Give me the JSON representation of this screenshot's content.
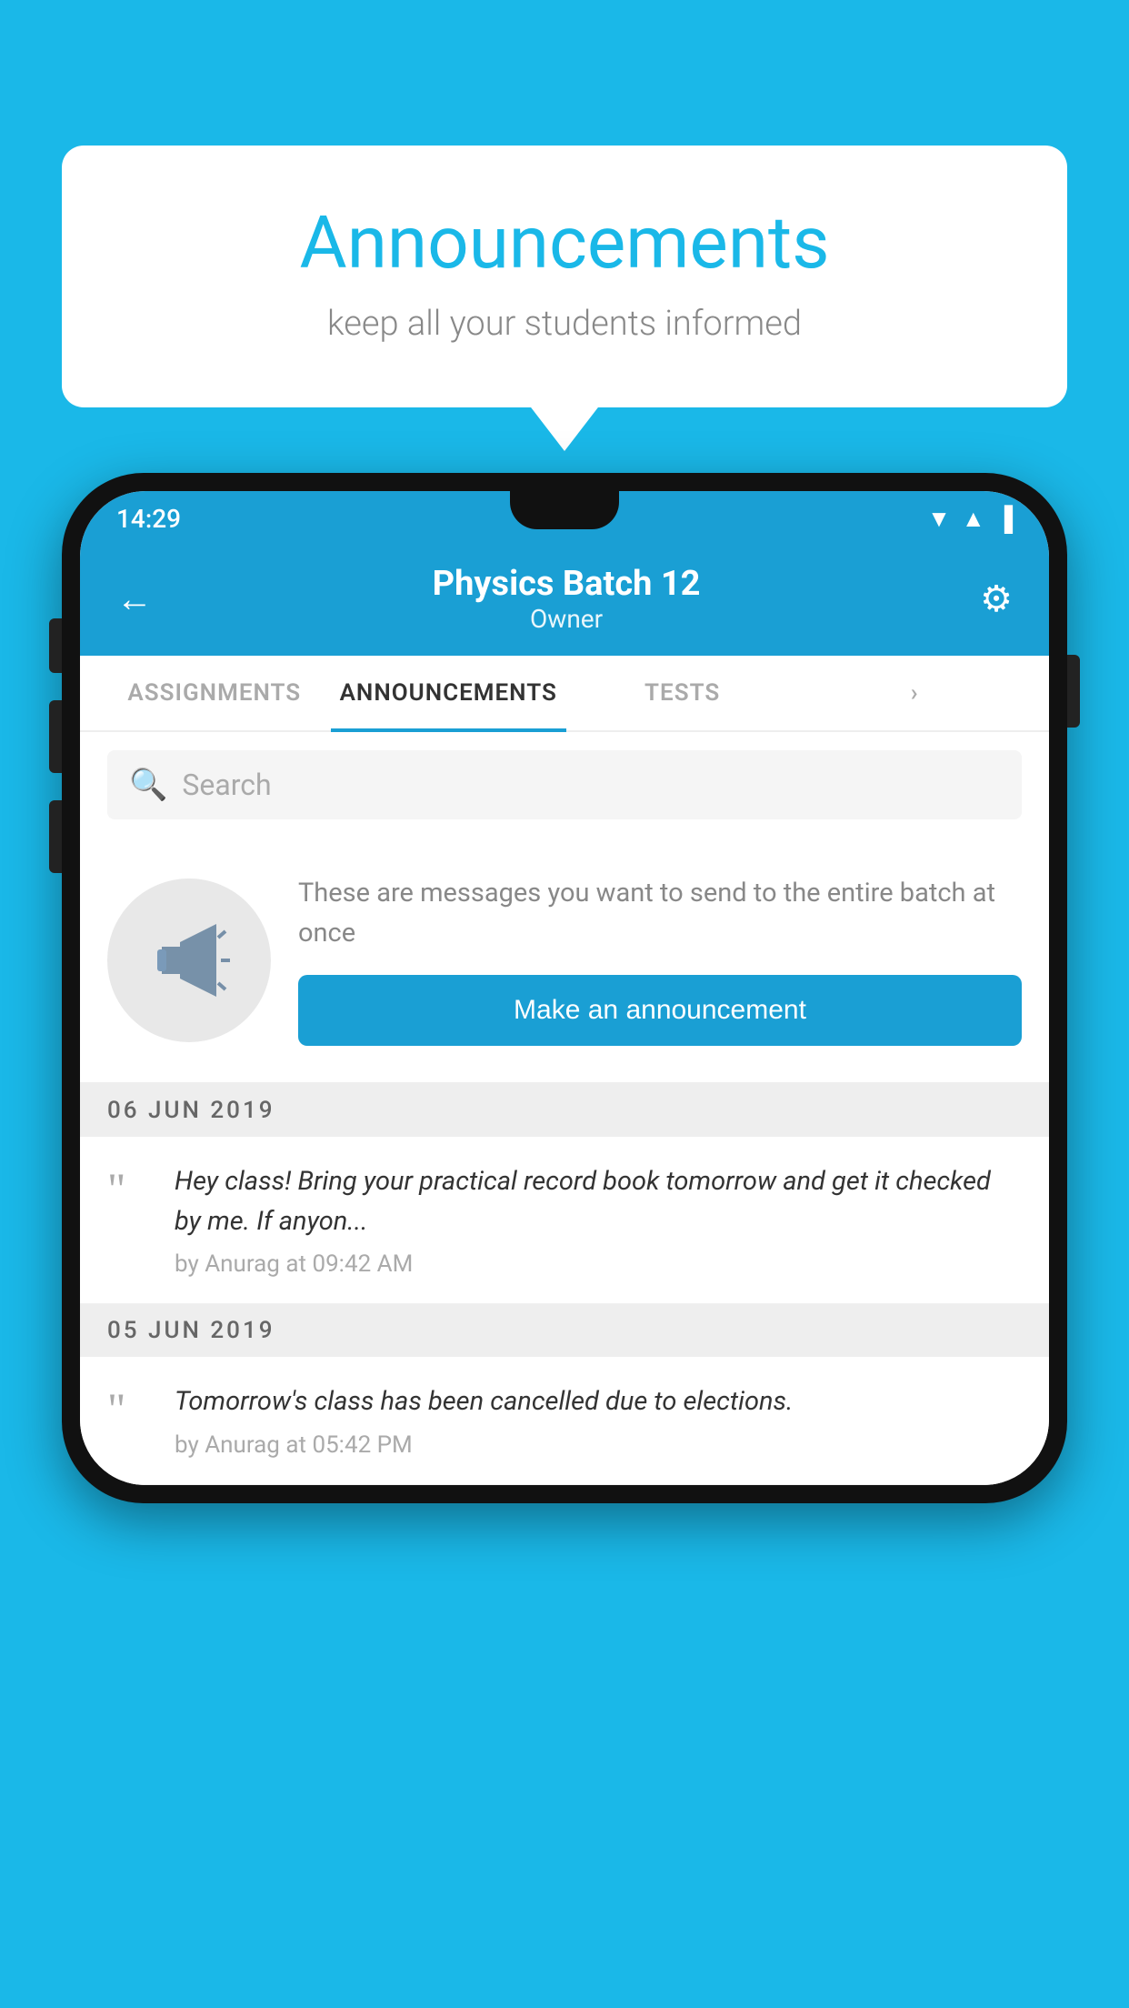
{
  "background_color": "#1ab8e8",
  "speech_bubble": {
    "title": "Announcements",
    "subtitle": "keep all your students informed"
  },
  "phone": {
    "status_bar": {
      "time": "14:29",
      "wifi": "▲",
      "signal": "▲",
      "battery": "▌"
    },
    "header": {
      "title": "Physics Batch 12",
      "subtitle": "Owner",
      "back_label": "←",
      "settings_label": "⚙"
    },
    "tabs": [
      {
        "label": "ASSIGNMENTS",
        "active": false
      },
      {
        "label": "ANNOUNCEMENTS",
        "active": true
      },
      {
        "label": "TESTS",
        "active": false
      },
      {
        "label": "›",
        "active": false
      }
    ],
    "search": {
      "placeholder": "Search"
    },
    "promo": {
      "description": "These are messages you want to\nsend to the entire batch at once",
      "button_label": "Make an announcement"
    },
    "announcements": [
      {
        "date": "06  JUN  2019",
        "text": "Hey class! Bring your practical record book tomorrow and get it checked by me. If anyon...",
        "meta": "by Anurag at 09:42 AM"
      },
      {
        "date": "05  JUN  2019",
        "text": "Tomorrow's class has been cancelled due to elections.",
        "meta": "by Anurag at 05:42 PM"
      }
    ]
  }
}
